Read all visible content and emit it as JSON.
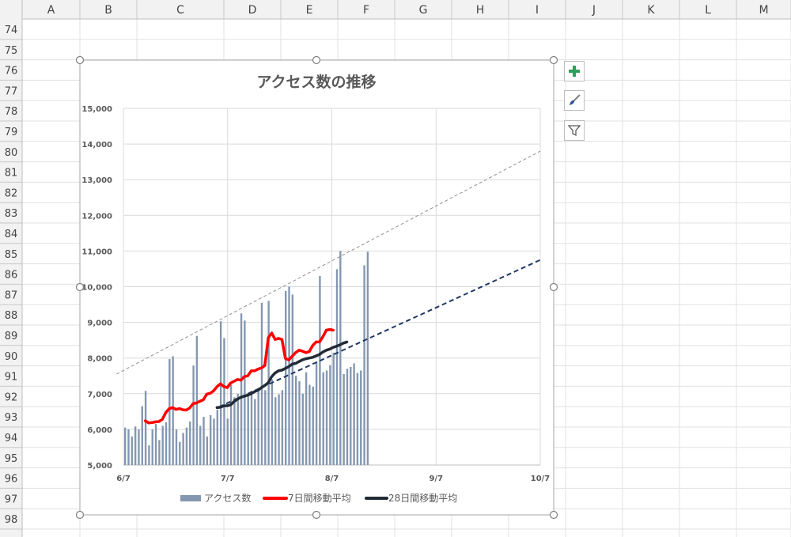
{
  "sheet": {
    "columns": [
      "A",
      "B",
      "C",
      "D",
      "E",
      "F",
      "G",
      "H",
      "I",
      "J",
      "K",
      "L",
      "M"
    ],
    "rows": [
      "74",
      "75",
      "76",
      "77",
      "78",
      "79",
      "80",
      "81",
      "82",
      "83",
      "84",
      "85",
      "86",
      "87",
      "88",
      "89",
      "90",
      "91",
      "92",
      "93",
      "94",
      "95",
      "96",
      "97",
      "98"
    ]
  },
  "side_buttons": [
    {
      "name": "chart-elements-button",
      "icon": "plus-icon"
    },
    {
      "name": "chart-styles-button",
      "icon": "brush-icon"
    },
    {
      "name": "chart-filters-button",
      "icon": "filter-icon"
    }
  ],
  "colors": {
    "bar": "#8497b0",
    "ma7": "#ff0000",
    "ma28": "#222a35",
    "trend_ma28": "#1f3864",
    "trend_peak": "#909090",
    "grid": "#d9d9d9",
    "title": "#595959",
    "axis_text": "#595959",
    "plus_icon": "#2e9e5b",
    "brush_icon": "#2f5597"
  },
  "chart_data": {
    "type": "bar",
    "title": "アクセス数の推移",
    "xlabel": "",
    "ylabel": "",
    "ylim": [
      5000,
      15000
    ],
    "y_ticks": [
      "5,000",
      "6,000",
      "7,000",
      "8,000",
      "9,000",
      "10,000",
      "11,000",
      "12,000",
      "13,000",
      "14,000",
      "15,000"
    ],
    "x_ticks": [
      "6/7",
      "7/7",
      "8/7",
      "9/7",
      "10/7"
    ],
    "x_range_days": [
      0,
      122
    ],
    "grid": true,
    "legend_position": "bottom",
    "series": [
      {
        "name": "アクセス数",
        "type": "bar",
        "start_day": 0,
        "values": [
          6050,
          6000,
          5800,
          6080,
          6000,
          6650,
          7080,
          5550,
          6000,
          6150,
          5700,
          6100,
          6200,
          7970,
          8050,
          6000,
          5650,
          5900,
          6050,
          6220,
          7790,
          8620,
          6100,
          6350,
          5800,
          6400,
          6300,
          6550,
          9030,
          8560,
          6300,
          7250,
          6900,
          7000,
          9250,
          9050,
          7000,
          7080,
          6850,
          7100,
          9550,
          7100,
          9600,
          7400,
          6900,
          6980,
          7100,
          9880,
          10000,
          9780,
          7500,
          7350,
          7000,
          7600,
          7250,
          7200,
          7900,
          10300,
          7600,
          7650,
          7800,
          8150,
          10490,
          11000,
          7550,
          7700,
          7750,
          7850,
          7580,
          7650,
          10600,
          10980
        ]
      },
      {
        "name": "7日間移動平均",
        "type": "line",
        "start_day": 6,
        "values": [
          6240,
          6180,
          6190,
          6210,
          6220,
          6280,
          6470,
          6580,
          6610,
          6560,
          6580,
          6550,
          6540,
          6600,
          6720,
          6740,
          6790,
          6830,
          6990,
          7010,
          7080,
          7200,
          7280,
          7200,
          7170,
          7300,
          7350,
          7400,
          7380,
          7480,
          7500,
          7640,
          7640,
          7690,
          7720,
          7790,
          8570,
          8700,
          8520,
          8550,
          8520,
          7990,
          7950,
          8050,
          8150,
          8220,
          8190,
          8150,
          8180,
          8350,
          8450,
          8450,
          8600,
          8780,
          8800,
          8780
        ]
      },
      {
        "name": "28日間移動平均",
        "type": "line",
        "start_day": 27,
        "values": [
          6610,
          6620,
          6660,
          6660,
          6690,
          6780,
          6850,
          6900,
          6930,
          6960,
          7000,
          7060,
          7100,
          7170,
          7230,
          7310,
          7480,
          7580,
          7640,
          7660,
          7710,
          7760,
          7830,
          7850,
          7900,
          7950,
          7980,
          8000,
          8020,
          8060,
          8100,
          8170,
          8220,
          8250,
          8300,
          8330,
          8370,
          8420,
          8450
        ]
      }
    ],
    "trendlines": [
      {
        "of": "28日間移動平均",
        "style": "dashed",
        "from": [
          28,
          6630
        ],
        "to": [
          122,
          10750
        ]
      },
      {
        "style": "dashed",
        "from": [
          -2,
          7550
        ],
        "to": [
          122,
          13800
        ]
      }
    ]
  }
}
